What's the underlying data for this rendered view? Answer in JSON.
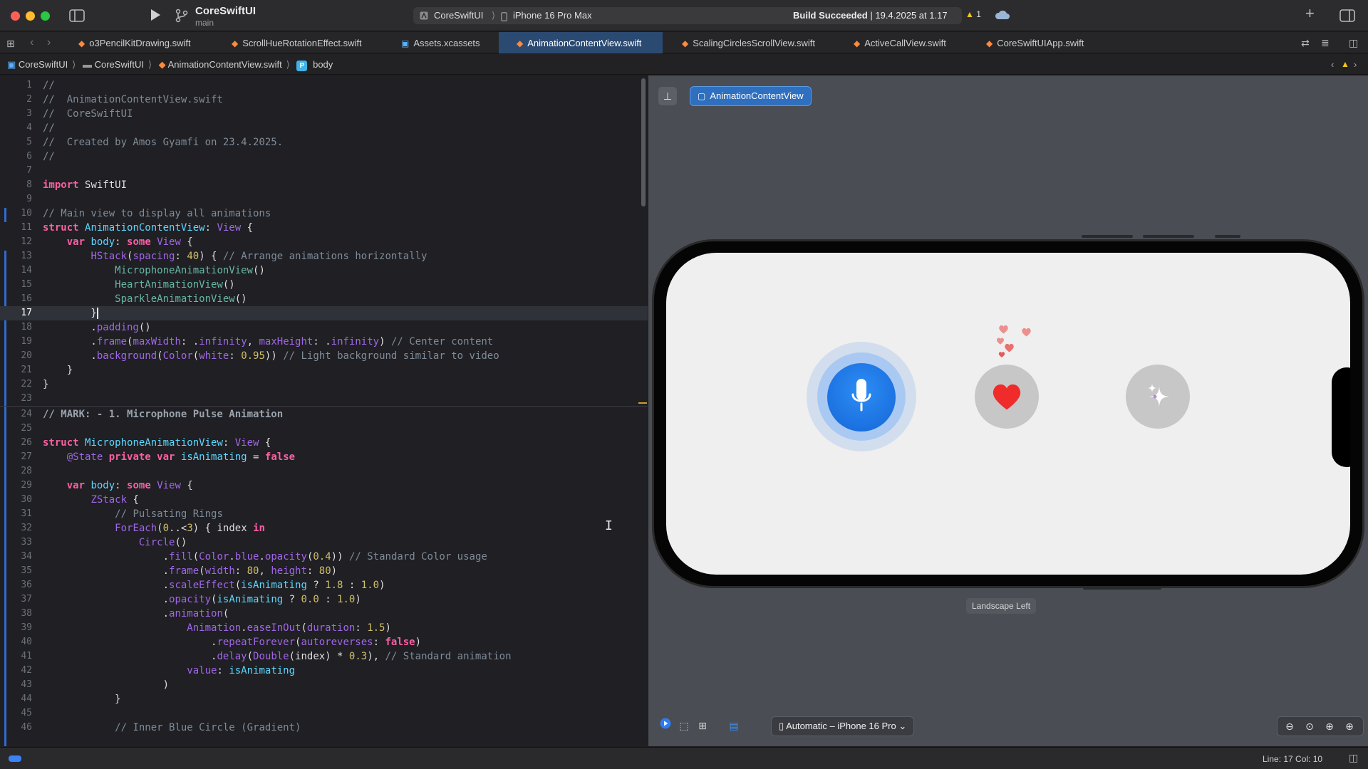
{
  "titlebar": {
    "project_name": "CoreSwiftUI",
    "branch": "main",
    "scheme": "CoreSwiftUI",
    "device": "iPhone 16 Pro Max",
    "build_status_bold": "Build Succeeded",
    "build_status_time": "19.4.2025 at 1.17",
    "warning_count": "1",
    "add_icon": "+"
  },
  "tabs": [
    {
      "label": "o3PencilKitDrawing.swift",
      "kind": "swift"
    },
    {
      "label": "ScrollHueRotationEffect.swift",
      "kind": "swift"
    },
    {
      "label": "Assets.xcassets",
      "kind": "assets"
    },
    {
      "label": "AnimationContentView.swift",
      "kind": "swift",
      "active": true
    },
    {
      "label": "ScalingCirclesScrollView.swift",
      "kind": "swift"
    },
    {
      "label": "ActiveCallView.swift",
      "kind": "swift"
    },
    {
      "label": "CoreSwiftUIApp.swift",
      "kind": "swift"
    }
  ],
  "breadcrumb": {
    "project": "CoreSwiftUI",
    "folder": "CoreSwiftUI",
    "file": "AnimationContentView.swift",
    "symbol": "body",
    "symbol_badge": "P"
  },
  "editor": {
    "current_line": 17,
    "line_numbers": [
      "1",
      "2",
      "3",
      "4",
      "5",
      "6",
      "7",
      "8",
      "9",
      "10",
      "11",
      "12",
      "13",
      "14",
      "15",
      "16",
      "17",
      "18",
      "19",
      "20",
      "21",
      "22",
      "23",
      "24",
      "25",
      "26",
      "27",
      "28",
      "29",
      "30",
      "31",
      "32",
      "33",
      "34",
      "35",
      "36",
      "37",
      "38",
      "39",
      "40",
      "41",
      "42",
      "43",
      "44",
      "45",
      "46"
    ]
  },
  "preview": {
    "chip_label": "AnimationContentView",
    "orientation_label": "Landscape Left",
    "device_select": "Automatic – iPhone 16 Pro",
    "colors": {
      "mic_blue": "#1a73e8",
      "heart_red": "#f02b2b",
      "canvas_bg": "#4a4d54"
    }
  },
  "status": {
    "line_col": "Line: 17  Col: 10"
  },
  "icons": {
    "run": "play-icon",
    "branch": "branch-icon",
    "sidebar": "sidebar-toggle-icon",
    "inspector": "inspector-toggle-icon",
    "pin": "pin-icon",
    "zoom_out": "zoom-out-icon",
    "zoom_fit": "zoom-fit-icon",
    "zoom_100": "zoom-actual-icon",
    "zoom_in": "zoom-in-icon"
  }
}
